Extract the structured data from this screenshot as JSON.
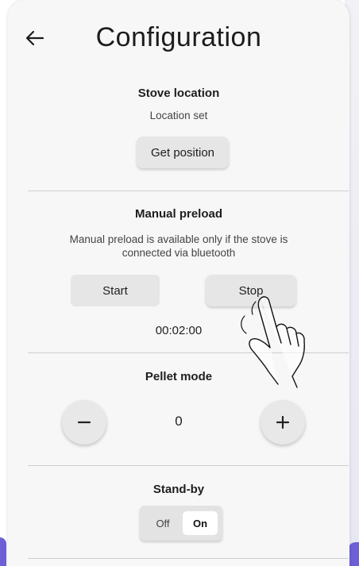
{
  "header": {
    "title": "Configuration",
    "back_icon": "arrow-left-icon"
  },
  "stove_location": {
    "title": "Stove location",
    "status": "Location set",
    "button_label": "Get position"
  },
  "manual_preload": {
    "title": "Manual preload",
    "note": "Manual preload is available only if the stove is connected via bluetooth",
    "start_label": "Start",
    "stop_label": "Stop",
    "timer": "00:02:00"
  },
  "pellet_mode": {
    "title": "Pellet mode",
    "value": "0",
    "decrement_icon": "minus-icon",
    "increment_icon": "plus-icon"
  },
  "standby": {
    "title": "Stand-by",
    "off_label": "Off",
    "on_label": "On",
    "selected": "On"
  },
  "colors": {
    "accent": "#6d5fd6",
    "background": "#f7f7f7",
    "button": "#e6e6e6"
  }
}
